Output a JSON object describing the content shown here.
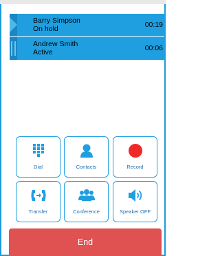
{
  "calls": [
    {
      "name": "Barry Simpson",
      "status": "On hold",
      "timer": "00:19",
      "state_icon": "play-icon"
    },
    {
      "name": "Andrew Smith",
      "status": "Active",
      "timer": "00:06",
      "state_icon": "pause-icon"
    }
  ],
  "actions": {
    "dial": {
      "label": "Dial",
      "icon": "dialpad-icon"
    },
    "contacts": {
      "label": "Contacts",
      "icon": "person-icon"
    },
    "record": {
      "label": "Record",
      "icon": "record-dot-icon"
    },
    "transfer": {
      "label": "Transfer",
      "icon": "transfer-icon"
    },
    "conference": {
      "label": "Conference",
      "icon": "group-icon"
    },
    "speaker": {
      "label": "Speaker OFF",
      "icon": "speaker-icon"
    }
  },
  "end_button": {
    "label": "End"
  },
  "colors": {
    "accent": "#1f9fe0",
    "end_red": "#e05152",
    "record_red": "#f02828"
  }
}
